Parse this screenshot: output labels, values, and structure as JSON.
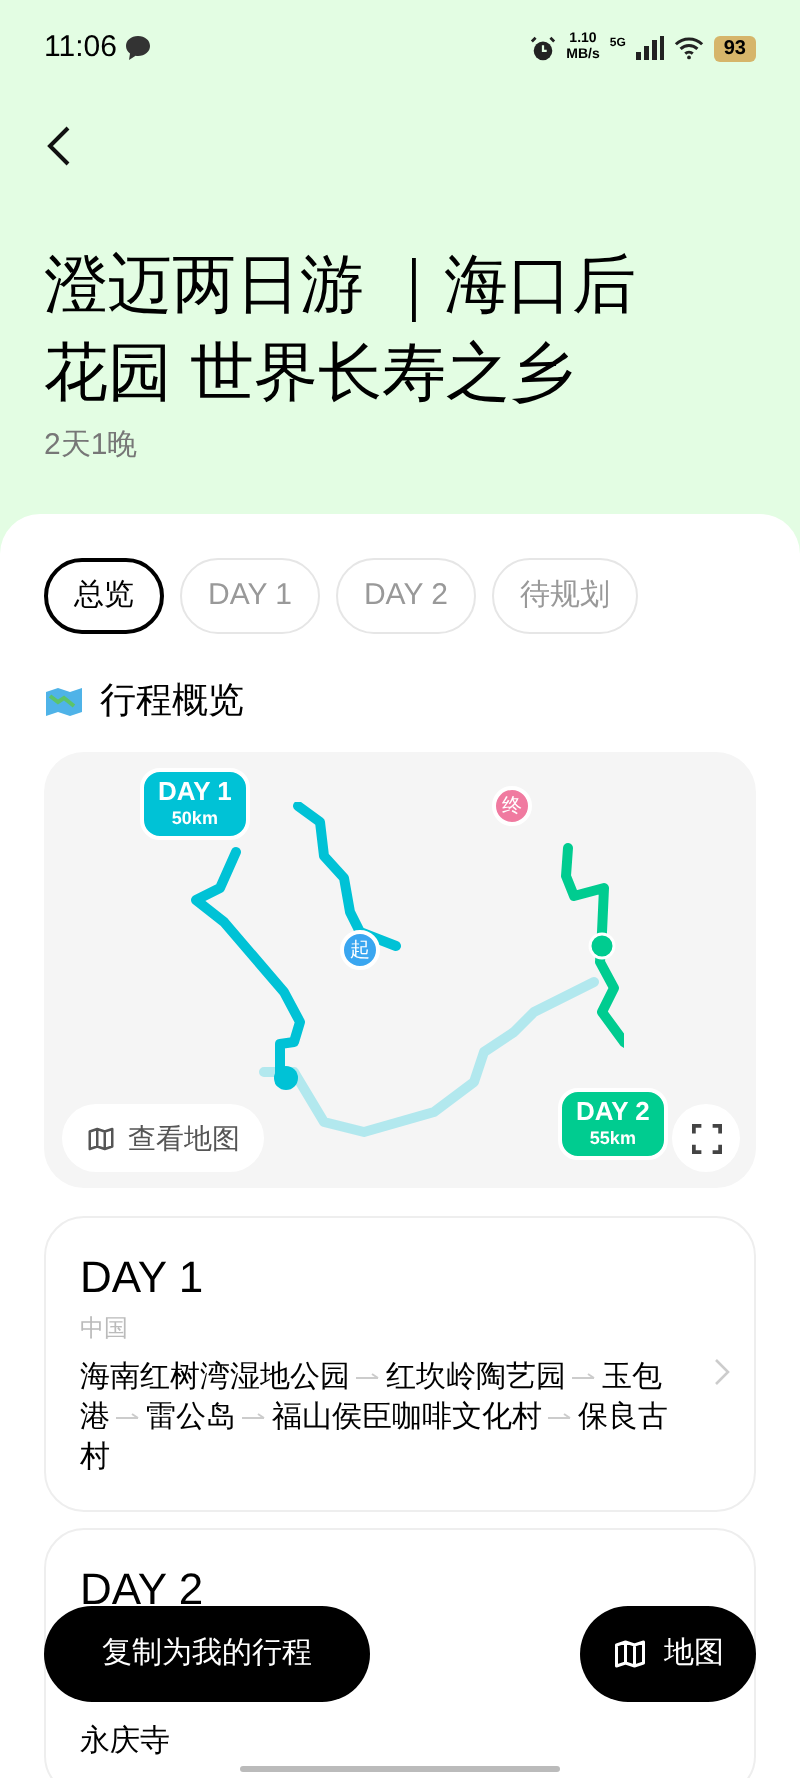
{
  "status_bar": {
    "time": "11:06",
    "speed_value": "1.10",
    "speed_unit": "MB/s",
    "network": "5G",
    "battery": "93"
  },
  "title": "澄迈两日游 ｜海口后花园 世界长寿之乡",
  "subtitle": "2天1晚",
  "tabs": [
    {
      "label": "总览",
      "selected": true
    },
    {
      "label": "DAY 1",
      "selected": false
    },
    {
      "label": "DAY 2",
      "selected": false
    },
    {
      "label": "待规划",
      "selected": false
    }
  ],
  "overview": {
    "heading": "行程概览",
    "map": {
      "day1_label": "DAY 1",
      "day1_distance": "50km",
      "day2_label": "DAY 2",
      "day2_distance": "55km",
      "start_marker": "起",
      "end_marker": "终",
      "view_map": "查看地图"
    }
  },
  "days": [
    {
      "title": "DAY 1",
      "region": "中国",
      "stops": [
        "海南红树湾湿地公园",
        "红坎岭陶艺园",
        "玉包港",
        "雷公岛",
        "福山侯臣咖啡文化村",
        "保良古村"
      ]
    },
    {
      "title": "DAY 2",
      "stops": [
        "永庆寺"
      ]
    }
  ],
  "actions": {
    "copy": "复制为我的行程",
    "map": "地图"
  }
}
